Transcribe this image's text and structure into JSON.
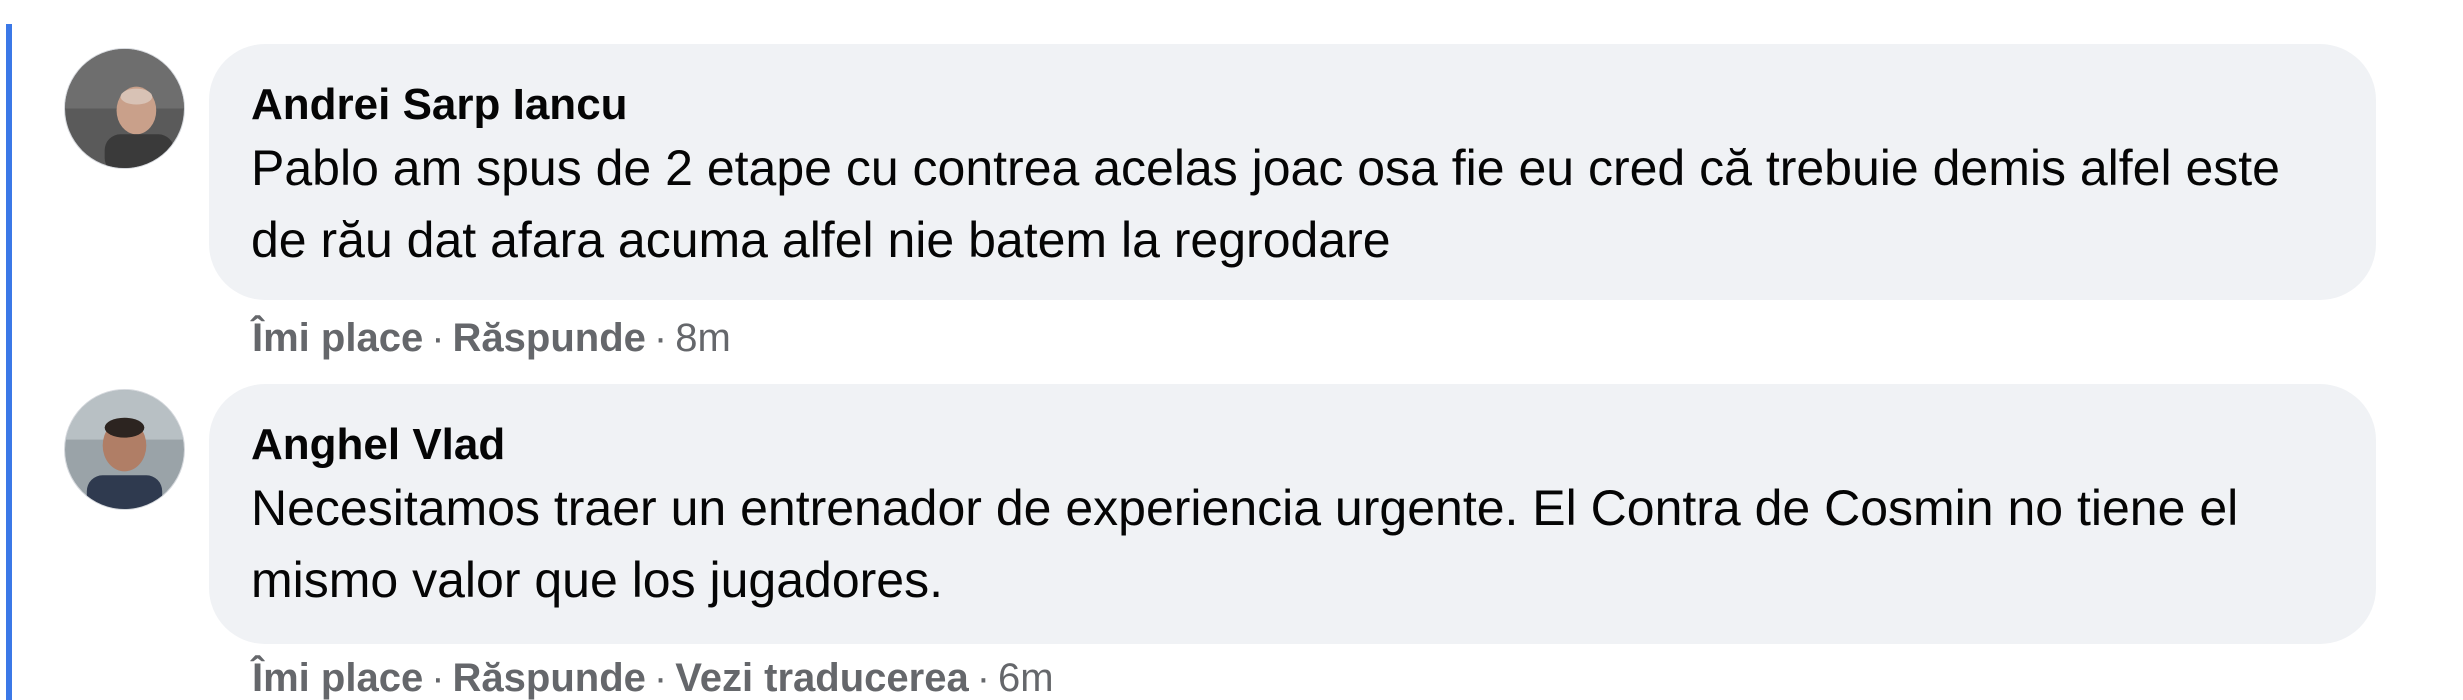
{
  "comments": [
    {
      "author": "Andrei Sarp Iancu",
      "text": "Pablo am spus de 2 etape cu contrea acelas joac osa fie eu cred că trebuie demis alfel este de rău dat afara acuma alfel nie batem la regrodare",
      "like": "Îmi place",
      "reply": "Răspunde",
      "time": "8m"
    },
    {
      "author": "Anghel Vlad",
      "text": "Necesitamos traer un entrenador de experiencia urgente. El Contra de Cosmin no tiene el mismo valor que los jugadores.",
      "like": "Îmi place",
      "reply": "Răspunde",
      "translate": "Vezi traducerea",
      "time": "6m"
    }
  ],
  "separator": "·",
  "colors": {
    "thread_line": "#3b78e7",
    "bubble_bg": "#f0f2f5",
    "secondary_text": "#65676b",
    "primary_text": "#050505"
  }
}
